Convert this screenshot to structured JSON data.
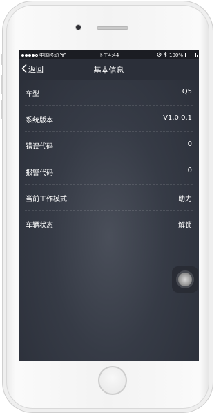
{
  "status": {
    "carrier": "中国移动",
    "time": "下午4:44",
    "battery": "100%",
    "signal_bars_filled": 4,
    "signal_bars_total": 5
  },
  "nav": {
    "back_label": "返回",
    "title": "基本信息"
  },
  "rows": [
    {
      "label": "车型",
      "value": "Q5"
    },
    {
      "label": "系统版本",
      "value": "V1.0.0.1"
    },
    {
      "label": "错误代码",
      "value": "0"
    },
    {
      "label": "报警代码",
      "value": "0"
    },
    {
      "label": "当前工作模式",
      "value": "助力"
    },
    {
      "label": "车辆状态",
      "value": "解锁"
    }
  ]
}
